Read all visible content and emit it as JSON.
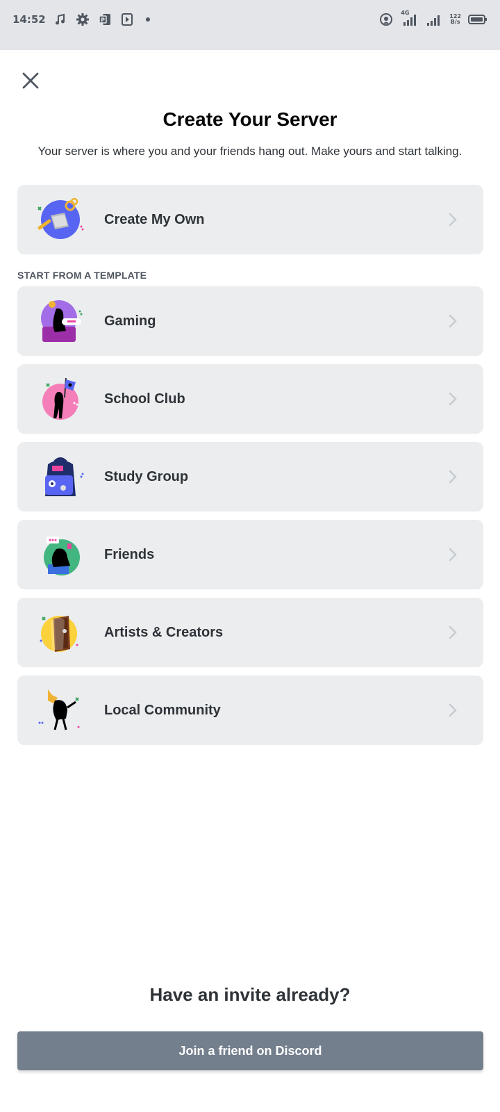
{
  "status_bar": {
    "time": "14:52",
    "network": "4G",
    "speed_top": "122",
    "speed_bottom": "B/s"
  },
  "header": {
    "title": "Create Your Server",
    "subtitle": "Your server is where you and your friends hang out. Make yours and start talking."
  },
  "create_own": {
    "label": "Create My Own",
    "icon": "create-own-illustration"
  },
  "templates": {
    "section_label": "START FROM A TEMPLATE",
    "items": [
      {
        "label": "Gaming",
        "icon": "gaming-illustration"
      },
      {
        "label": "School Club",
        "icon": "school-club-illustration"
      },
      {
        "label": "Study Group",
        "icon": "study-group-illustration"
      },
      {
        "label": "Friends",
        "icon": "friends-illustration"
      },
      {
        "label": "Artists & Creators",
        "icon": "artists-illustration"
      },
      {
        "label": "Local Community",
        "icon": "local-community-illustration"
      }
    ]
  },
  "invite": {
    "title": "Have an invite already?",
    "button_label": "Join a friend on Discord"
  },
  "colors": {
    "card_bg": "#ebedef",
    "button_bg": "#747f8d",
    "status_bar_bg": "#e3e5e8",
    "blurple": "#5865f2"
  }
}
